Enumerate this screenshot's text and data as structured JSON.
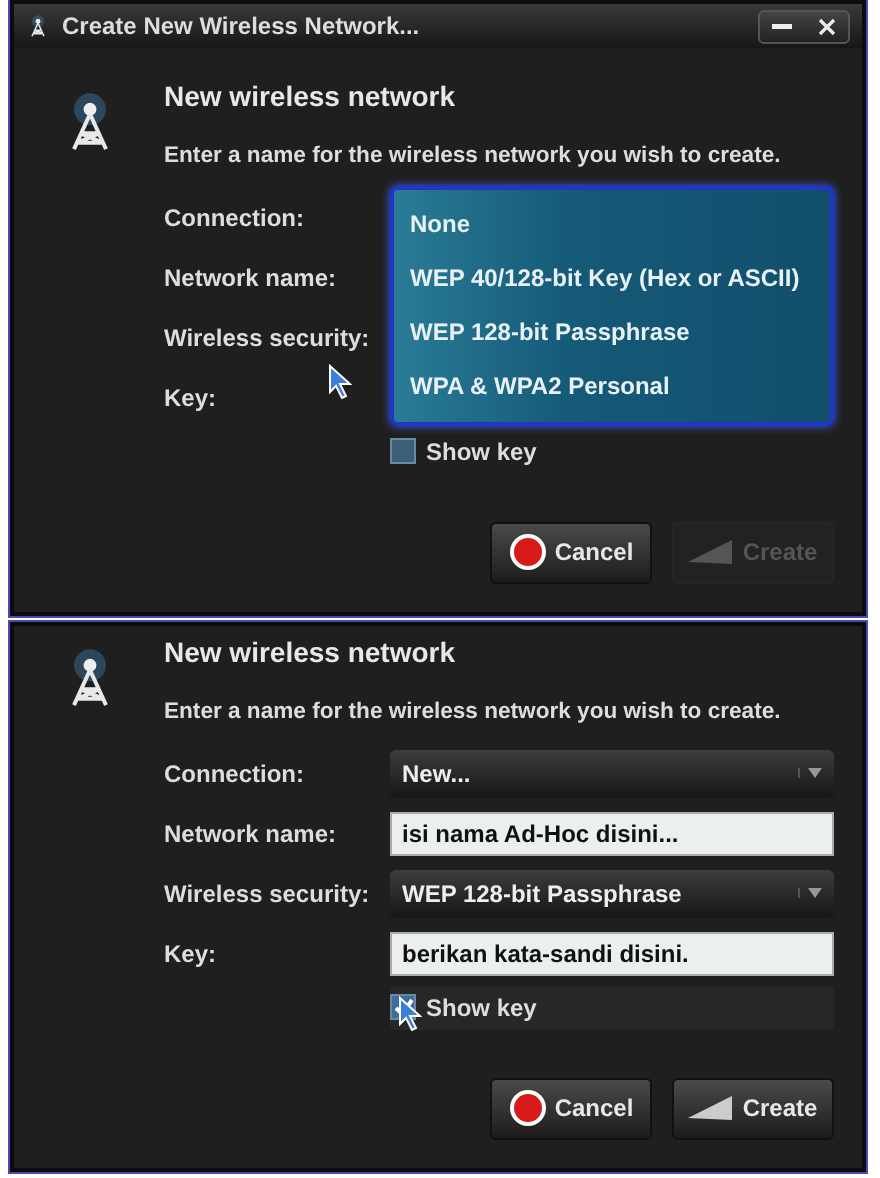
{
  "dialogs": [
    {
      "title": "Create New Wireless Network...",
      "heading": "New wireless network",
      "description": "Enter a name for the wireless network you wish to create.",
      "fields": [
        {
          "label": "Connection:"
        },
        {
          "label": "Network name:"
        },
        {
          "label": "Wireless security:"
        },
        {
          "label": "Key:"
        }
      ],
      "open_list": {
        "options": [
          {
            "label": "None",
            "selected": false
          },
          {
            "label": "WEP 40/128-bit Key (Hex or ASCII)",
            "selected": false
          },
          {
            "label": "WEP 128-bit Passphrase",
            "selected": false
          },
          {
            "label": "WPA & WPA2 Personal",
            "selected": false
          }
        ]
      },
      "show_key": {
        "label": "Show key",
        "checked": false
      },
      "buttons": [
        {
          "label": "Cancel",
          "kind": "cancel",
          "disabled": false
        },
        {
          "label": "Create",
          "kind": "create",
          "disabled": true
        }
      ]
    },
    {
      "heading": "New wireless network",
      "description": "Enter a name for the wireless network you wish to create.",
      "fields": [
        {
          "label": "Connection:",
          "kind": "combo",
          "value": "New..."
        },
        {
          "label": "Network name:",
          "kind": "entry",
          "value": "isi nama Ad-Hoc disini..."
        },
        {
          "label": "Wireless security:",
          "kind": "combo",
          "value": "WEP 128-bit Passphrase"
        },
        {
          "label": "Key:",
          "kind": "entry",
          "value": "berikan kata-sandi disini."
        }
      ],
      "show_key": {
        "label": "Show key",
        "checked": true
      },
      "buttons": [
        {
          "label": "Cancel",
          "kind": "cancel",
          "disabled": false
        },
        {
          "label": "Create",
          "kind": "create",
          "disabled": false
        }
      ]
    }
  ]
}
